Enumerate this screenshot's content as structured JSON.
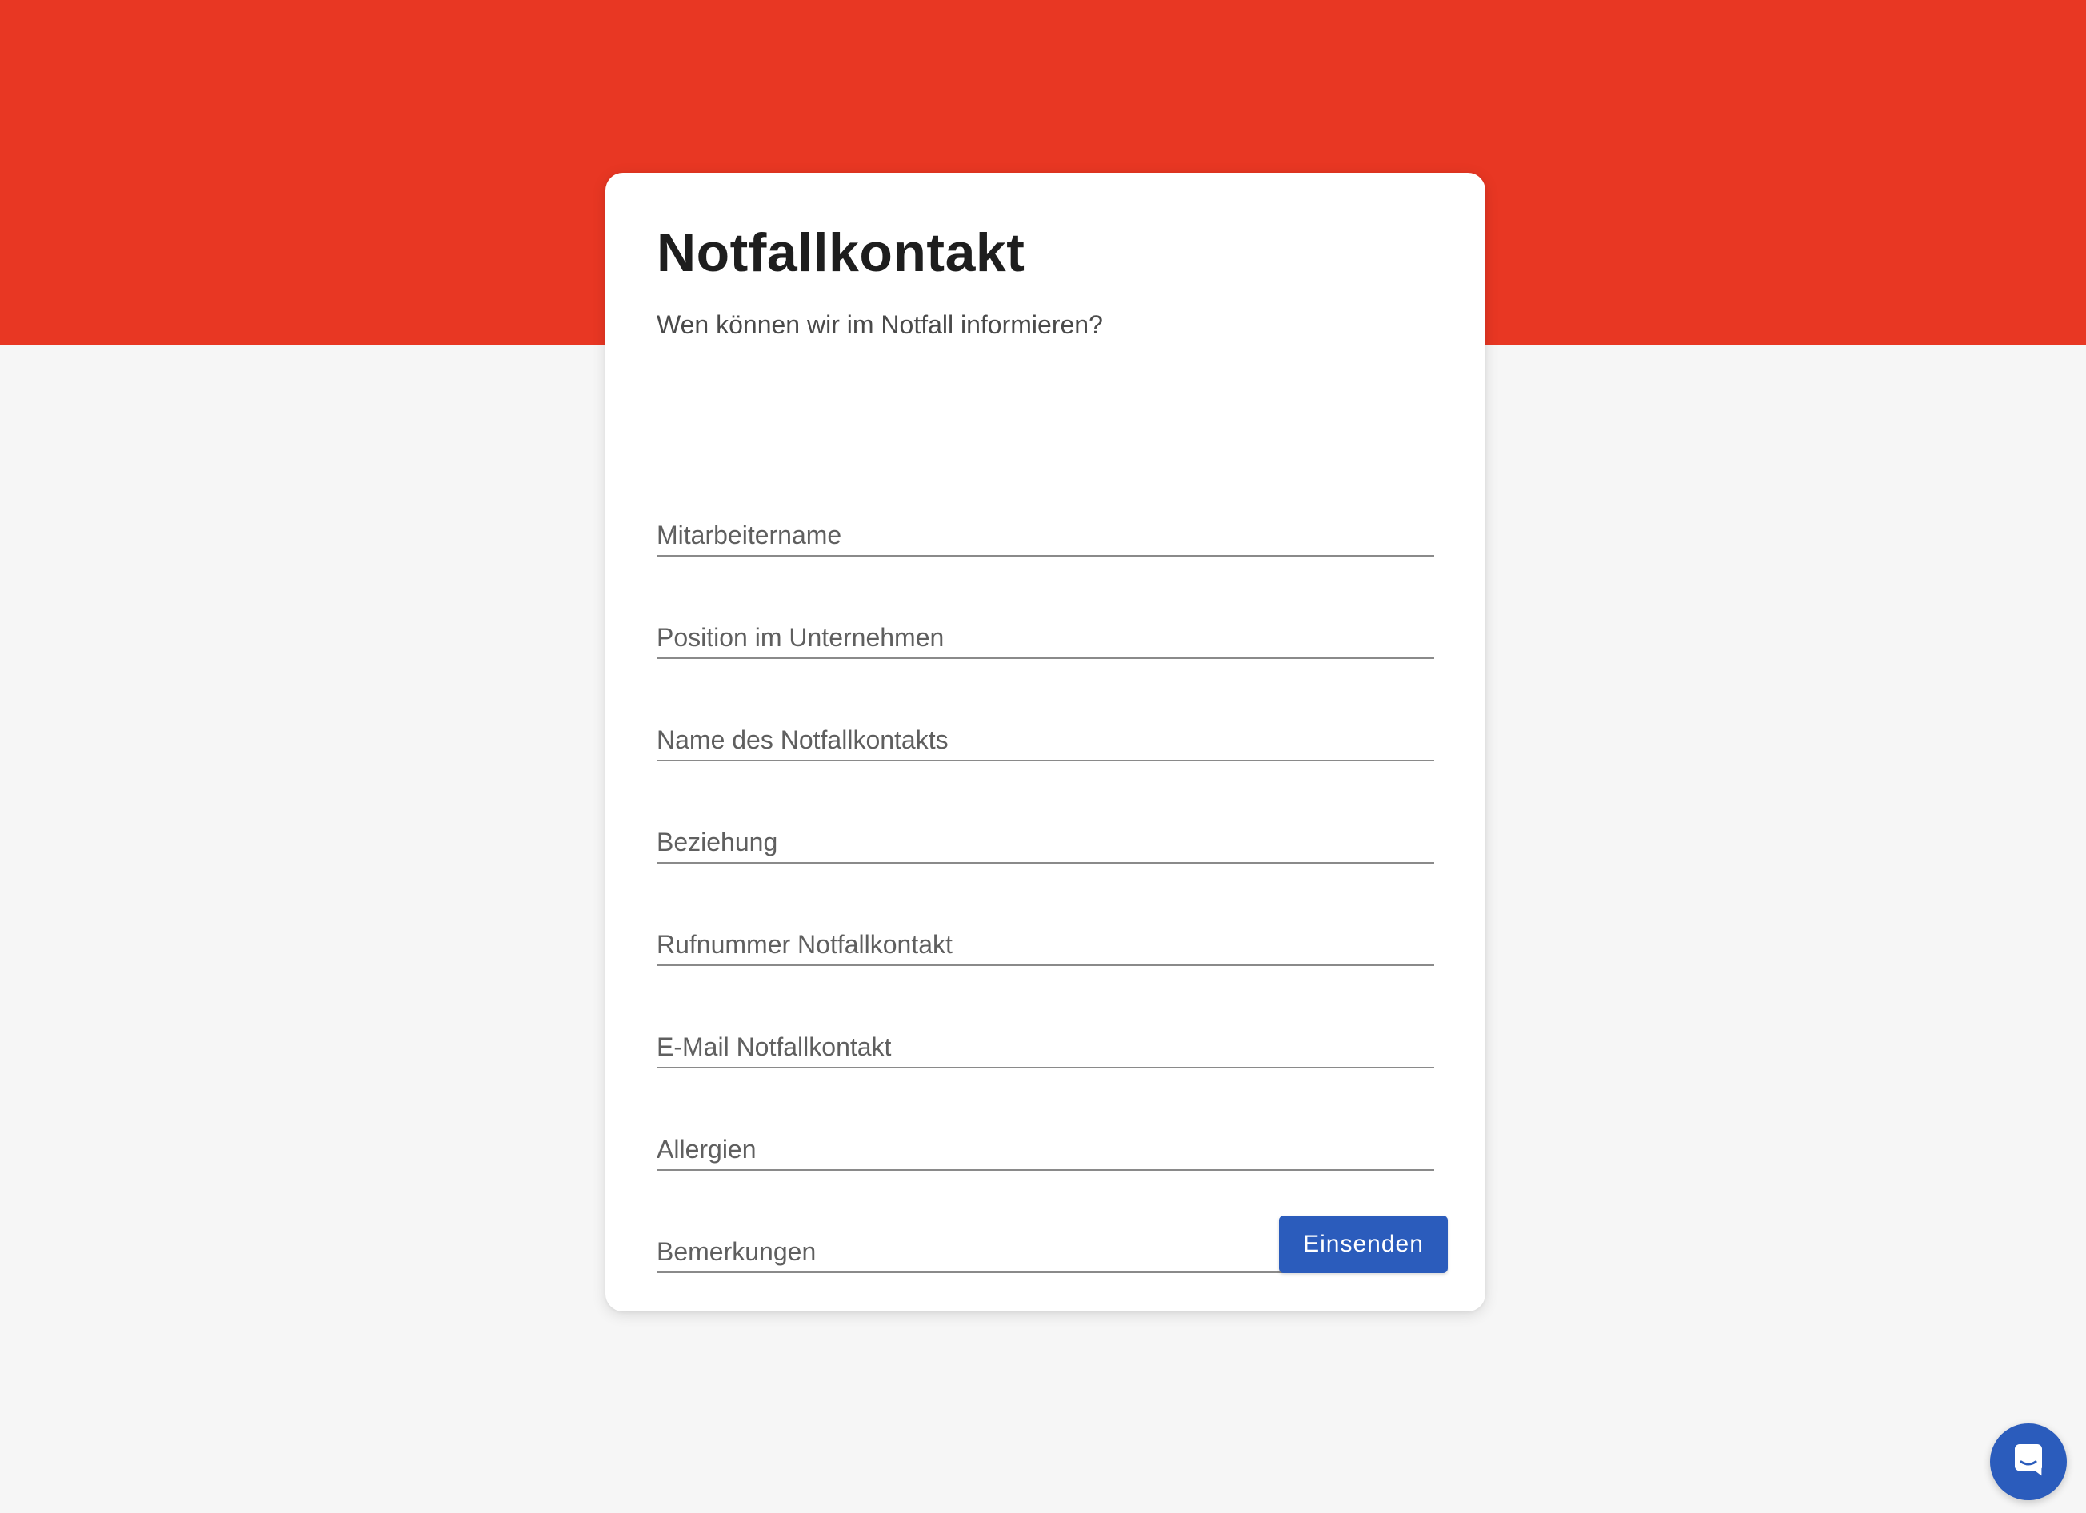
{
  "colors": {
    "brand_red": "#e83723",
    "page_background": "#f6f6f6",
    "button_blue": "#2b5cbc"
  },
  "form": {
    "title": "Notfallkontakt",
    "subtitle": "Wen können wir im Notfall informieren?",
    "fields": [
      {
        "placeholder": "Mitarbeitername",
        "value": ""
      },
      {
        "placeholder": "Position im Unternehmen",
        "value": ""
      },
      {
        "placeholder": "Name des Notfallkontakts",
        "value": ""
      },
      {
        "placeholder": "Beziehung",
        "value": ""
      },
      {
        "placeholder": "Rufnummer Notfallkontakt",
        "value": ""
      },
      {
        "placeholder": "E-Mail Notfallkontakt",
        "value": ""
      },
      {
        "placeholder": "Allergien",
        "value": ""
      },
      {
        "placeholder": "Bemerkungen",
        "value": ""
      }
    ],
    "submit_label": "Einsenden"
  },
  "chat_launcher": {
    "icon": "chat-bubble-icon"
  }
}
